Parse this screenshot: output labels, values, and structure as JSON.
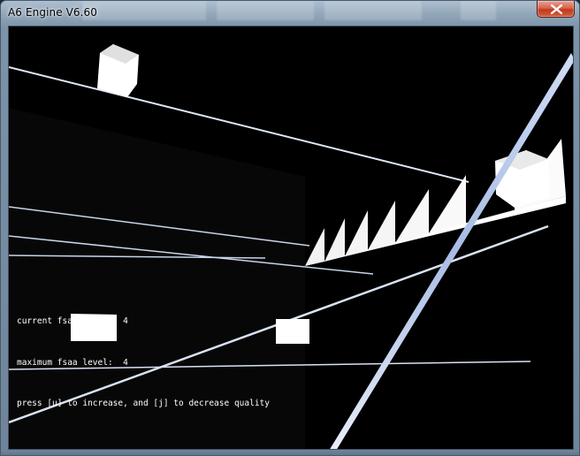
{
  "window": {
    "title": "A6 Engine V6.60"
  },
  "controls": {
    "close_icon": "close-icon"
  },
  "viewport": {
    "background": "#000000",
    "overlay_lines": [
      "current fsaa level:  4",
      "maximum fsaa level:  4",
      "press [u] to increase, and [j] to decrease quality"
    ]
  },
  "colors": {
    "titlebar": "#93a8bb",
    "close_button": "#c1391f",
    "line_color": "#dfe8f7",
    "object_color": "#ffffff"
  }
}
